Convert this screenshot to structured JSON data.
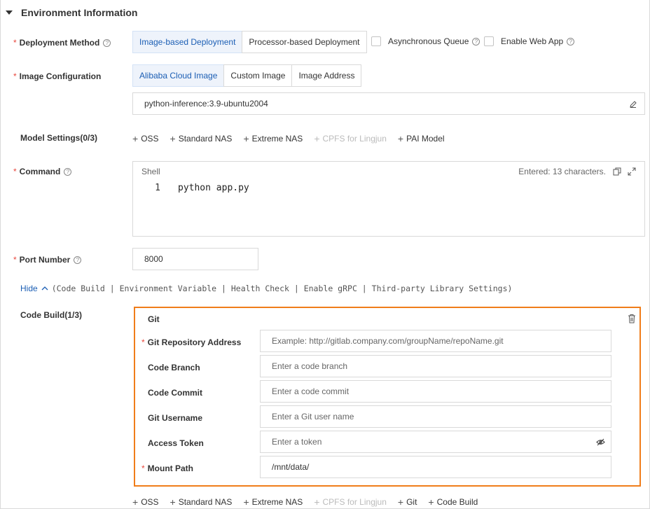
{
  "section": {
    "title": "Environment Information"
  },
  "deployment": {
    "label": "Deployment Method",
    "options": [
      "Image-based Deployment",
      "Processor-based Deployment"
    ],
    "async_queue": "Asynchronous Queue",
    "web_app": "Enable Web App"
  },
  "image_config": {
    "label": "Image Configuration",
    "options": [
      "Alibaba Cloud Image",
      "Custom Image",
      "Image Address"
    ],
    "value": "python-inference:3.9-ubuntu2004"
  },
  "model_settings": {
    "label": "Model Settings(0/3)",
    "items": [
      "OSS",
      "Standard NAS",
      "Extreme NAS",
      "CPFS for Lingjun",
      "PAI Model"
    ]
  },
  "command": {
    "label": "Command",
    "shell_label": "Shell",
    "entered": "Entered: 13 characters.",
    "line_number": "1",
    "code": "python app.py"
  },
  "port": {
    "label": "Port Number",
    "value": "8000"
  },
  "hide_bar": {
    "hide": "Hide",
    "links": "(Code Build | Environment Variable | Health Check | Enable gRPC | Third-party Library Settings)"
  },
  "code_build": {
    "label": "Code Build(1/3)",
    "git_title": "Git",
    "fields": {
      "repo": {
        "label": "Git Repository Address",
        "placeholder": "Example: http://gitlab.company.com/groupName/repoName.git"
      },
      "branch": {
        "label": "Code Branch",
        "placeholder": "Enter a code branch"
      },
      "commit": {
        "label": "Code Commit",
        "placeholder": "Enter a code commit"
      },
      "username": {
        "label": "Git Username",
        "placeholder": "Enter a Git user name"
      },
      "token": {
        "label": "Access Token",
        "placeholder": "Enter a token"
      },
      "mount": {
        "label": "Mount Path",
        "value": "/mnt/data/"
      }
    },
    "add_items": [
      "OSS",
      "Standard NAS",
      "Extreme NAS",
      "CPFS for Lingjun",
      "Git",
      "Code Build"
    ]
  },
  "colors": {
    "accent": "#1b5eb4",
    "highlight": "#f07d1a",
    "required": "#e8473d"
  }
}
